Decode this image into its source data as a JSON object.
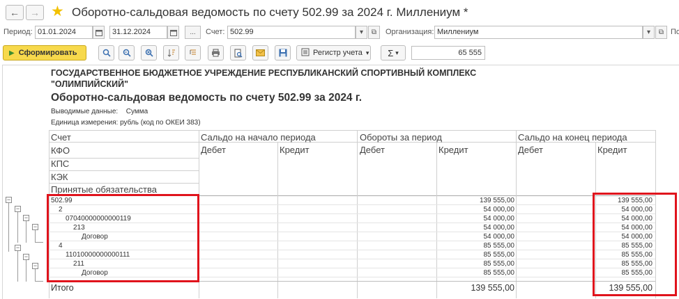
{
  "window": {
    "title": "Оборотно-сальдовая ведомость по счету 502.99 за 2024 г. Миллениум *"
  },
  "params": {
    "period_label": "Период:",
    "date_from": "01.01.2024",
    "date_to": "31.12.2024",
    "ellipsis": "...",
    "account_label": "Счет:",
    "account_value": "502.99",
    "org_label": "Организация:",
    "org_value": "Миллениум",
    "cut_label": "По"
  },
  "toolbar": {
    "generate_label": "Сформировать",
    "register_label": "Регистр учета",
    "sum_label": "Σ",
    "sum_value": "65 555"
  },
  "report": {
    "org_line1": "ГОСУДАРСТВЕННОЕ БЮДЖЕТНОЕ УЧРЕЖДЕНИЕ РЕСПУБЛИКАНСКИЙ СПОРТИВНЫЙ КОМПЛЕКС",
    "org_line2": "\"ОЛИМПИЙСКИЙ\"",
    "title": "Оборотно-сальдовая ведомость по счету 502.99 за 2024 г.",
    "output_label": "Выводимые данные:",
    "output_value": "Сумма",
    "unit_line": "Единица измерения: рубль (код по ОКЕИ 383)",
    "headers": {
      "account": "Счет",
      "kfo": "КФО",
      "kps": "КПС",
      "kek": "КЭК",
      "obligations": "Принятые обязательства",
      "opening": "Сальдо на начало периода",
      "turnover": "Обороты за период",
      "closing": "Сальдо на конец периода",
      "debit": "Дебет",
      "credit": "Кредит"
    },
    "rows": [
      {
        "label": "502.99",
        "turnover_credit": "139 555,00",
        "closing_credit": "139 555,00"
      },
      {
        "label": "2",
        "turnover_credit": "54 000,00",
        "closing_credit": "54 000,00"
      },
      {
        "label": "07040000000000119",
        "turnover_credit": "54 000,00",
        "closing_credit": "54 000,00"
      },
      {
        "label": "213",
        "turnover_credit": "54 000,00",
        "closing_credit": "54 000,00"
      },
      {
        "label": "Договор",
        "turnover_credit": "54 000,00",
        "closing_credit": "54 000,00"
      },
      {
        "label": "4",
        "turnover_credit": "85 555,00",
        "closing_credit": "85 555,00"
      },
      {
        "label": "11010000000000111",
        "turnover_credit": "85 555,00",
        "closing_credit": "85 555,00"
      },
      {
        "label": "211",
        "turnover_credit": "85 555,00",
        "closing_credit": "85 555,00"
      },
      {
        "label": "Договор",
        "turnover_credit": "85 555,00",
        "closing_credit": "85 555,00"
      }
    ],
    "total": {
      "label": "Итого",
      "turnover_credit": "139 555,00",
      "closing_credit": "139 555,00"
    }
  },
  "colors": {
    "highlight": "#e0131c",
    "generate_button": "#f7d94c",
    "star": "#f2c100"
  }
}
